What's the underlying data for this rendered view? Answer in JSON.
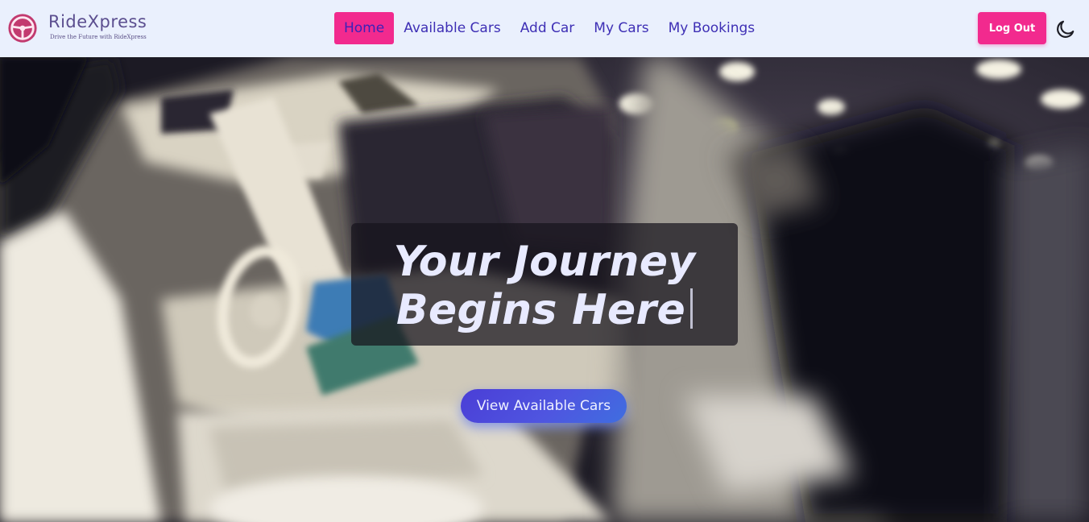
{
  "brand": {
    "name": "RideXpress",
    "tagline": "Drive the Future with RideXpress",
    "logo_icon": "steering-wheel-icon"
  },
  "nav": {
    "links": [
      {
        "label": "Home",
        "active": true
      },
      {
        "label": "Available Cars",
        "active": false
      },
      {
        "label": "Add Car",
        "active": false
      },
      {
        "label": "My Cars",
        "active": false
      },
      {
        "label": "My Bookings",
        "active": false
      }
    ],
    "logout_label": "Log Out",
    "theme_icon": "moon-icon"
  },
  "hero": {
    "headline_line1": "Your Journey",
    "headline_line2": "Begins Here",
    "cta_label": "View Available Cars",
    "background": "car-interior-video"
  },
  "colors": {
    "navbar_bg": "#eaf0fd",
    "accent_pink": "#f22a8e",
    "nav_text": "#3e2fb5",
    "cta_gradient_start": "#4a3ed6",
    "cta_gradient_end": "#3f6ee0"
  }
}
